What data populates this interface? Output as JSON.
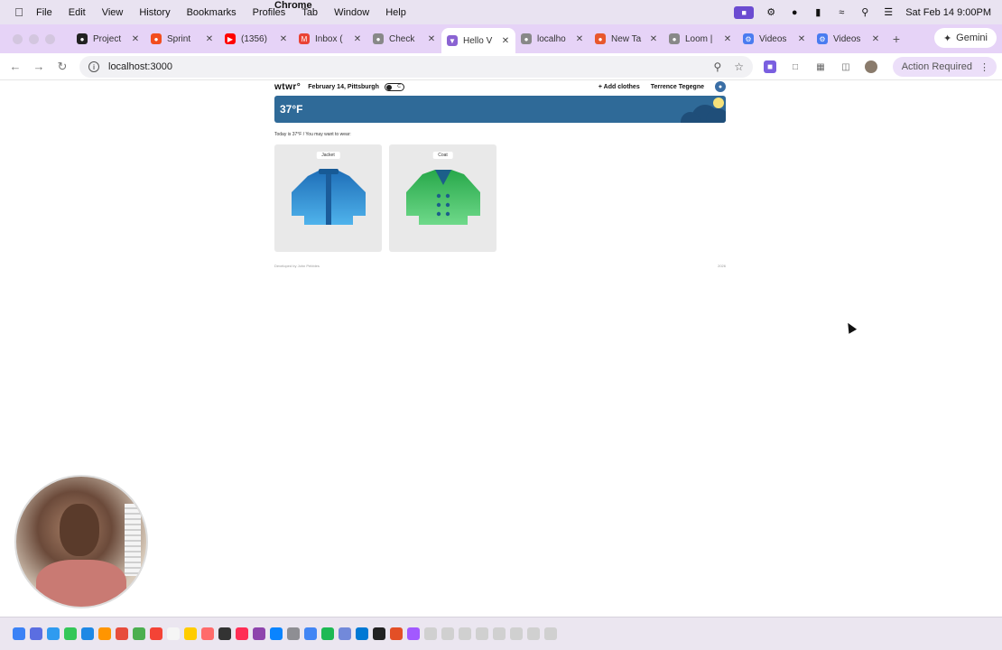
{
  "menubar": {
    "app": "Chrome",
    "items": [
      "File",
      "Edit",
      "View",
      "History",
      "Bookmarks",
      "Profiles",
      "Tab",
      "Window",
      "Help"
    ],
    "clock": "Sat Feb 14  9:00PM"
  },
  "tabs": [
    {
      "label": "Project",
      "color": "#222222"
    },
    {
      "label": "Sprint",
      "color": "#f24e1e"
    },
    {
      "label": "(1356)",
      "color": "#ff0000"
    },
    {
      "label": "Inbox (",
      "color": "#ea4335"
    },
    {
      "label": "Check",
      "color": "#888888"
    },
    {
      "label": "Hello V",
      "color": "#8a63d2",
      "active": true
    },
    {
      "label": "localho",
      "color": "#888888"
    },
    {
      "label": "New Ta",
      "color": "#e8582c"
    },
    {
      "label": "Loom |",
      "color": "#888888"
    },
    {
      "label": "Videos",
      "color": "#4a7cf0"
    },
    {
      "label": "Videos",
      "color": "#4a7cf0"
    }
  ],
  "gemini_label": "Gemini",
  "address": {
    "url": "localhost:3000"
  },
  "action_required": "Action Required",
  "app": {
    "logo": "wtwr°",
    "date": "February 14, Pittsburgh",
    "toggle_label": "C",
    "add_clothes": "+ Add clothes",
    "username": "Terrence Tegegne",
    "temperature": "37°F",
    "subtitle": "Today is 37°F / You may want to wear:",
    "cards": [
      {
        "label": "Jacket",
        "color": "#3a9ad9"
      },
      {
        "label": "Coat",
        "color": "#4cc46a"
      }
    ],
    "footer_left": "Developed by John Pebbles",
    "footer_right": "2026"
  }
}
